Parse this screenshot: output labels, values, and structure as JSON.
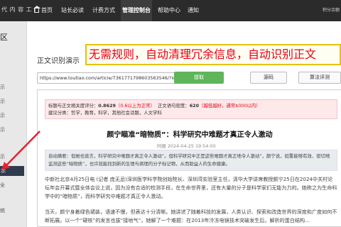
{
  "topnav": {
    "brand": "代 内 容 工 厂",
    "items": [
      "首页",
      "站长必读",
      "计费方式",
      "管理控制台",
      "帮助中心",
      "通知"
    ],
    "active_index": 3,
    "points": "积分余额"
  },
  "sidebar": {
    "title": "区",
    "items": [
      "示",
      "示",
      "示",
      "示",
      "示"
    ],
    "active_item": "示",
    "items_bottom": [
      "全",
      "统"
    ]
  },
  "main": {
    "heading": "正文识别演示",
    "banner": "无需规则，自动清理冗余信息，自动识别正文",
    "url_value": "https://www.toutiao.com/article/7361771798603563546/?log_frc",
    "extract_button": "提取",
    "source_button": "源码",
    "algo_button": "算法评测"
  },
  "article": {
    "stats_line1": [
      "标题与正文相关度评分：",
      "0.8629",
      "（0.6以上为正常）",
      "正文语句密度：",
      "620",
      "（越低越好，通常$000以内）"
    ],
    "stats_line2": "建议分类：哲学，教育，科学，其他社会话题，人文学科",
    "headline": "颜宁瞄准“暗物质”：科学研究中难题才真正令人激动",
    "byline": "时报 2024-04-25 19:54:00",
    "summary": "自动摘要：但她也直言，科学研究中难题才真正令人激动”。但科学研究中正是这些难题才真正地令人激动”，颜宁说，如重能够有效、密切地监测这些“暗物质”，也许就能找到新的生理与病理的分子标记物，从而助益人的生命健康。",
    "para1": "中新社北京4月25日电 (记者 庞无忌)深圳医学科学院创始院长、深圳湾实验室主任，清华大学讲席教授颜宁25日在2024中关村论坛年会开幕式暨全体会议上说，因为没有合适的检测手段，在生命世界里，还有大量的分子是科学家们无能为力的。她称之为生命科学中的“暗物质”，而科学研究中难题才真正令人激动。",
    "para2": "当天，颜宁身着绿色裙装，语速不慢，但表达十分清晰。她讲述了随着科技的发展，人类认识、探索和改造世界的深度和广度如何不断拓展。以一个“硬核”的发言也拔“接地气”，她解了一个难题：在2013年冷冻电镜技术突破发生后，解析的蛋白结构..."
  }
}
